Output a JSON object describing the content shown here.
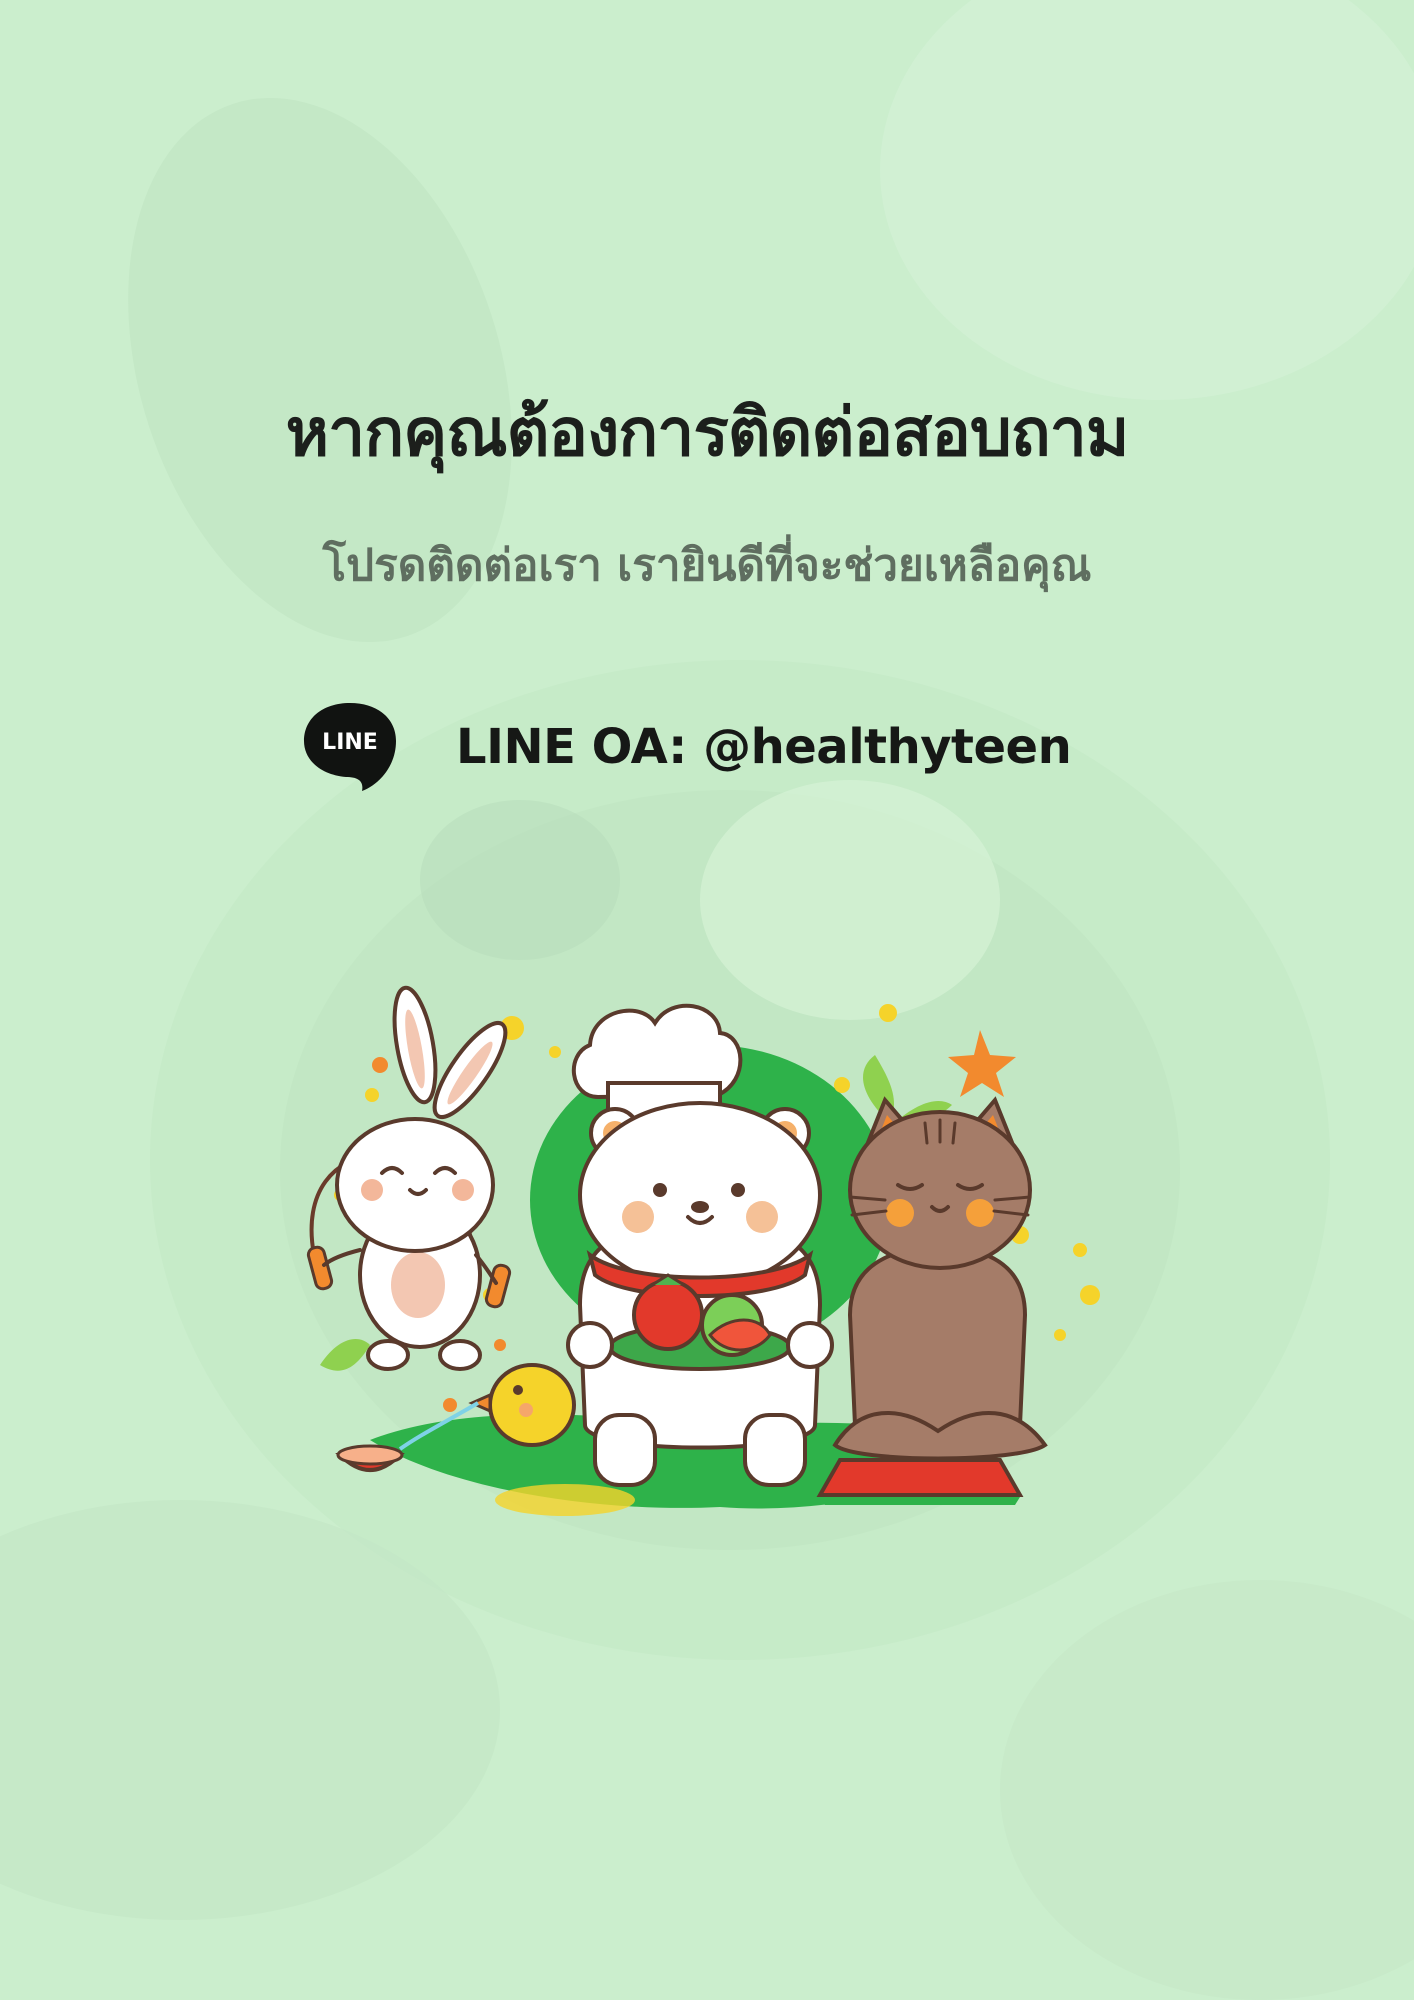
{
  "poster": {
    "title": "หากคุณต้องการติดต่อสอบถาม",
    "subtitle": "โปรดติดต่อเรา เรายินดีที่จะช่วยเหลือคุณ",
    "contact": {
      "logo_text": "LINE",
      "text": "LINE OA: @healthyteen",
      "icon": "line-logo-icon"
    },
    "illustration": {
      "characters": [
        "rabbit-jump-rope",
        "bear-chef",
        "chick-drinking-water",
        "cat-meditating"
      ]
    },
    "colors": {
      "background": "#cbeecd",
      "accent_green": "#2eb24a",
      "title_text": "#1c1f1c",
      "subtitle_text": "#5f6e60"
    }
  }
}
